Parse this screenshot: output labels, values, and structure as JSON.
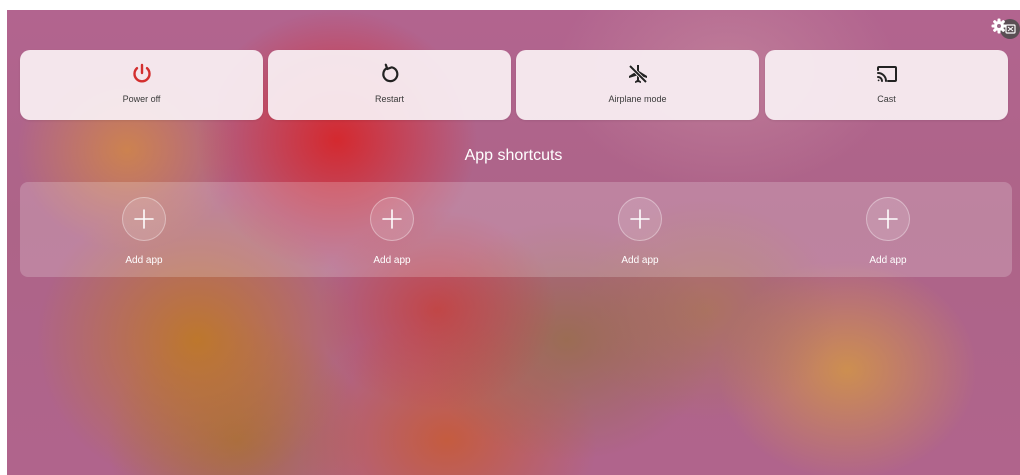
{
  "quick_actions": [
    {
      "label": "Power off",
      "icon": "power-icon",
      "color": "#d32f2f"
    },
    {
      "label": "Restart",
      "icon": "restart-icon",
      "color": "#222222"
    },
    {
      "label": "Airplane mode",
      "icon": "airplane-off-icon",
      "color": "#222222"
    },
    {
      "label": "Cast",
      "icon": "cast-icon",
      "color": "#222222"
    }
  ],
  "app_shortcuts": {
    "title": "App shortcuts",
    "slots": [
      {
        "label": "Add app",
        "icon": "plus-icon"
      },
      {
        "label": "Add app",
        "icon": "plus-icon"
      },
      {
        "label": "Add app",
        "icon": "plus-icon"
      },
      {
        "label": "Add app",
        "icon": "plus-icon"
      }
    ]
  },
  "corner_button": {
    "icon": "settings-gear-icon"
  }
}
